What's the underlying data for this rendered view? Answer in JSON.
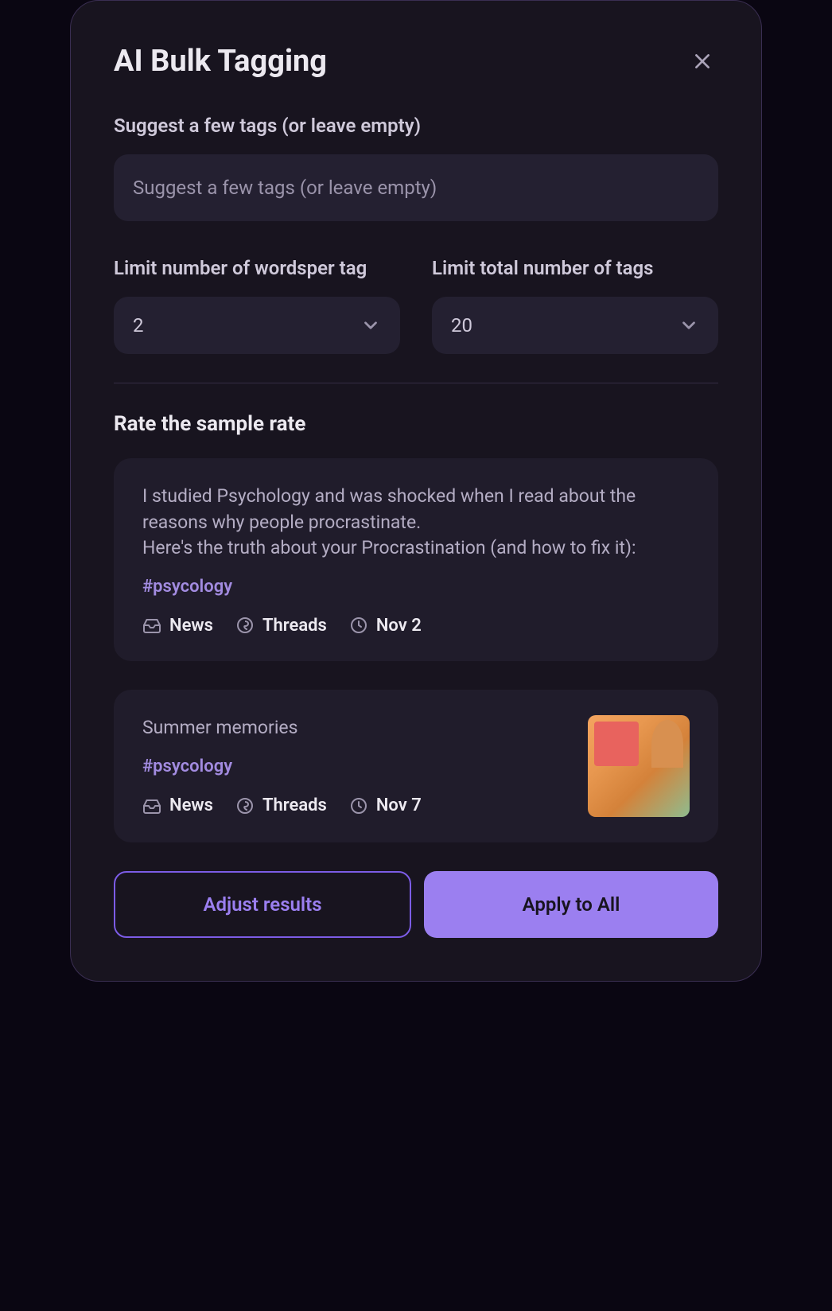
{
  "modal": {
    "title": "AI Bulk Tagging",
    "tags_label": "Suggest a few tags (or leave empty)",
    "tags_placeholder": "Suggest a few tags (or leave empty)",
    "words_label": "Limit number of wordsper tag",
    "words_value": "2",
    "total_label": "Limit total number of tags",
    "total_value": "20",
    "section_title": "Rate the sample rate"
  },
  "samples": [
    {
      "text": "I studied Psychology and was shocked when I read about the reasons why people procrastinate.\nHere's the truth about your Procrastination (and how to fix it):",
      "tag": "#psycology",
      "category": "News",
      "network": "Threads",
      "date": "Nov 2",
      "has_image": false
    },
    {
      "text": "Summer memories",
      "tag": "#psycology",
      "category": "News",
      "network": "Threads",
      "date": "Nov 7",
      "has_image": true
    }
  ],
  "buttons": {
    "adjust": "Adjust results",
    "apply": "Apply to All"
  }
}
